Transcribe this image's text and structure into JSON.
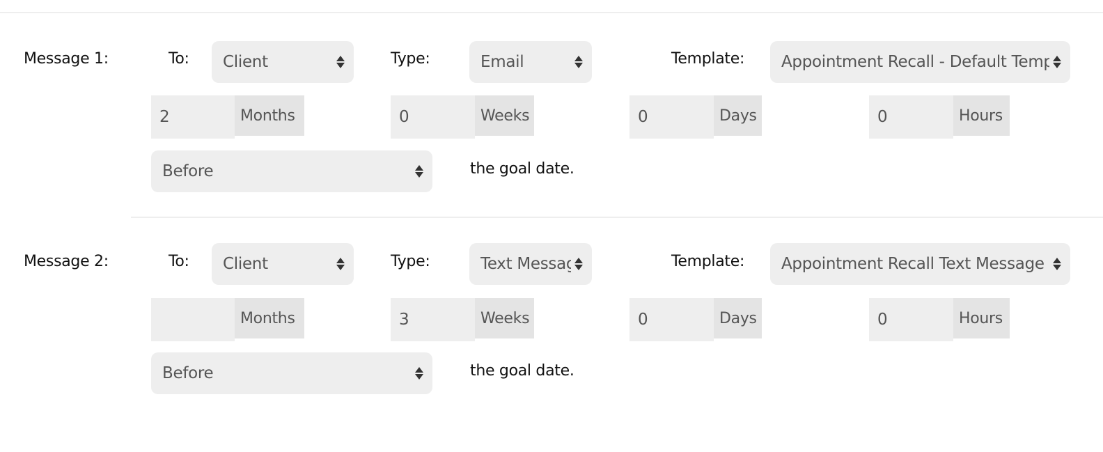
{
  "messages": [
    {
      "label": "Message 1:",
      "to_label": "To:",
      "to_value": "Client",
      "type_label": "Type:",
      "type_value": "Email",
      "template_label": "Template:",
      "template_value": "Appointment Recall - Default Template",
      "months_value": "2",
      "months_unit": "Months",
      "weeks_value": "0",
      "weeks_unit": "Weeks",
      "days_value": "0",
      "days_unit": "Days",
      "hours_value": "0",
      "hours_unit": "Hours",
      "relation_value": "Before",
      "goal_text": "the goal date."
    },
    {
      "label": "Message 2:",
      "to_label": "To:",
      "to_value": "Client",
      "type_label": "Type:",
      "type_value": "Text Message",
      "template_label": "Template:",
      "template_value": "Appointment Recall Text Message",
      "months_value": "",
      "months_unit": "Months",
      "weeks_value": "3",
      "weeks_unit": "Weeks",
      "days_value": "0",
      "days_unit": "Days",
      "hours_value": "0",
      "hours_unit": "Hours",
      "relation_value": "Before",
      "goal_text": "the goal date."
    }
  ],
  "icons": {
    "select_arrows": "up-down-arrows-icon"
  },
  "colors": {
    "field_bg": "#eeeeee",
    "unit_bg": "#e4e4e4",
    "field_text": "#555555",
    "label_text": "#111111"
  }
}
